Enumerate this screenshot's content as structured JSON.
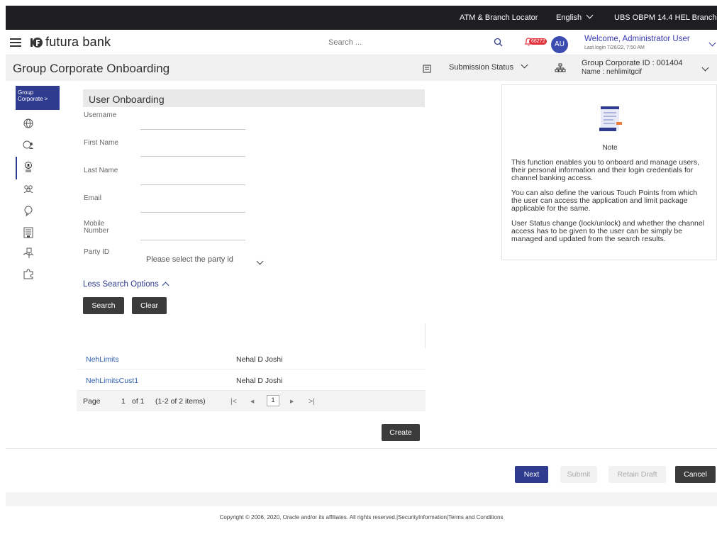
{
  "topbar": {
    "atm_locator": "ATM & Branch Locator",
    "language": "English",
    "branch": "UBS OBPM 14.4 HEL Branch"
  },
  "header": {
    "logo_text": "futura bank",
    "search_placeholder": "Search ...",
    "notification_count": "66272",
    "avatar_initials": "AU",
    "welcome": "Welcome, Administrator User",
    "last_login": "Last login 7/26/22, 7:50 AM"
  },
  "page": {
    "title": "Group Corporate Onboarding",
    "submission_status": "Submission Status",
    "group_corporate_id": "Group Corporate ID : 001404",
    "group_corporate_name": "Name : nehlimitgcif"
  },
  "leftnav": {
    "active_label_line1": "Group",
    "active_label_line2": "Corporate >",
    "icons": [
      "globe-icon",
      "users-globe-icon",
      "user-badge-icon",
      "user-group-icon",
      "lightbulb-icon",
      "building-icon",
      "handshake-icon",
      "puzzle-icon"
    ]
  },
  "form": {
    "section_title": "User Onboarding",
    "labels": {
      "username": "Username",
      "first_name": "First Name",
      "last_name": "Last Name",
      "email": "Email",
      "mobile_line1": "Mobile",
      "mobile_line2": "Number",
      "party_id": "Party ID"
    },
    "party_placeholder": "Please select the party id",
    "less_search_options": "Less Search Options",
    "search_button": "Search",
    "clear_button": "Clear"
  },
  "results": {
    "rows": [
      {
        "username": "NehLimits",
        "name": "Nehal D Joshi"
      },
      {
        "username": "NehLimitsCust1",
        "name": "Nehal D Joshi"
      }
    ],
    "pager": {
      "page_label": "Page",
      "page_num": "1",
      "of_label": "of 1",
      "items_label": "(1-2 of 2 items)",
      "first": "|<",
      "prev": "◂",
      "current": "1",
      "next": "▸",
      "last": ">|"
    },
    "create_button": "Create"
  },
  "actions": {
    "next": "Next",
    "submit": "Submit",
    "retain_draft": "Retain Draft",
    "cancel": "Cancel"
  },
  "note": {
    "title": "Note",
    "p1": "This function enables you to onboard and manage users, their personal information and their login credentials for channel banking access.",
    "p2": "You can also define the various Touch Points from which the user can access the application and limit package applicable for the same.",
    "p3": "User Status change (lock/unlock) and whether the channel access has to be given to the user can be simply be managed and updated from the search results."
  },
  "footer": {
    "text": "Copyright © 2006, 2020, Oracle and/or its affiliates. All rights reserved.|SecurityInformation|Terms and Conditions"
  }
}
